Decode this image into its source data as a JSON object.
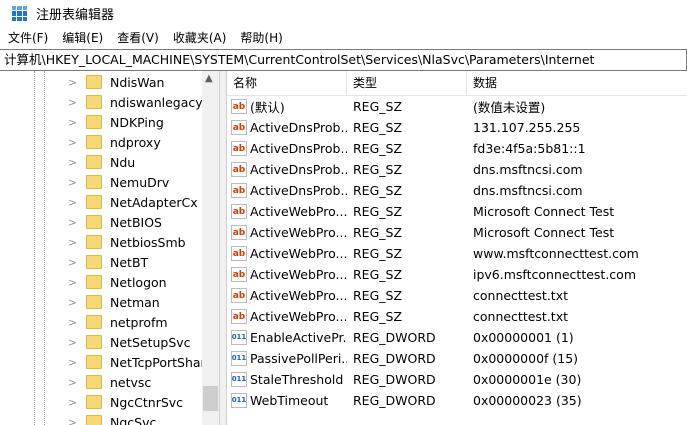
{
  "window": {
    "title": "注册表编辑器"
  },
  "menu": [
    "文件(F)",
    "编辑(E)",
    "查看(V)",
    "收藏夹(A)",
    "帮助(H)"
  ],
  "address": "计算机\\HKEY_LOCAL_MACHINE\\SYSTEM\\CurrentControlSet\\Services\\NlaSvc\\Parameters\\Internet",
  "tree": [
    "NdisWan",
    "ndiswanlegacy",
    "NDKPing",
    "ndproxy",
    "Ndu",
    "NemuDrv",
    "NetAdapterCx",
    "NetBIOS",
    "NetbiosSmb",
    "NetBT",
    "Netlogon",
    "Netman",
    "netprofm",
    "NetSetupSvc",
    "NetTcpPortSharing",
    "netvsc",
    "NgcCtnrSvc",
    "NgcSvc"
  ],
  "columns": {
    "name": "名称",
    "type": "类型",
    "data": "数据"
  },
  "values": [
    {
      "icon": "ab",
      "name": "(默认)",
      "type": "REG_SZ",
      "data": "(数值未设置)"
    },
    {
      "icon": "ab",
      "name": "ActiveDnsProb...",
      "type": "REG_SZ",
      "data": "131.107.255.255"
    },
    {
      "icon": "ab",
      "name": "ActiveDnsProb...",
      "type": "REG_SZ",
      "data": "fd3e:4f5a:5b81::1"
    },
    {
      "icon": "ab",
      "name": "ActiveDnsProb...",
      "type": "REG_SZ",
      "data": "dns.msftncsi.com"
    },
    {
      "icon": "ab",
      "name": "ActiveDnsProb...",
      "type": "REG_SZ",
      "data": "dns.msftncsi.com"
    },
    {
      "icon": "ab",
      "name": "ActiveWebPro...",
      "type": "REG_SZ",
      "data": "Microsoft Connect Test"
    },
    {
      "icon": "ab",
      "name": "ActiveWebPro...",
      "type": "REG_SZ",
      "data": "Microsoft Connect Test"
    },
    {
      "icon": "ab",
      "name": "ActiveWebPro...",
      "type": "REG_SZ",
      "data": "www.msftconnecttest.com"
    },
    {
      "icon": "ab",
      "name": "ActiveWebPro...",
      "type": "REG_SZ",
      "data": "ipv6.msftconnecttest.com"
    },
    {
      "icon": "ab",
      "name": "ActiveWebPro...",
      "type": "REG_SZ",
      "data": "connecttest.txt"
    },
    {
      "icon": "ab",
      "name": "ActiveWebPro...",
      "type": "REG_SZ",
      "data": "connecttest.txt"
    },
    {
      "icon": "011",
      "name": "EnableActivePr...",
      "type": "REG_DWORD",
      "data": "0x00000001 (1)"
    },
    {
      "icon": "011",
      "name": "PassivePollPeri...",
      "type": "REG_DWORD",
      "data": "0x0000000f (15)"
    },
    {
      "icon": "011",
      "name": "StaleThreshold",
      "type": "REG_DWORD",
      "data": "0x0000001e (30)"
    },
    {
      "icon": "011",
      "name": "WebTimeout",
      "type": "REG_DWORD",
      "data": "0x00000023 (35)"
    }
  ]
}
